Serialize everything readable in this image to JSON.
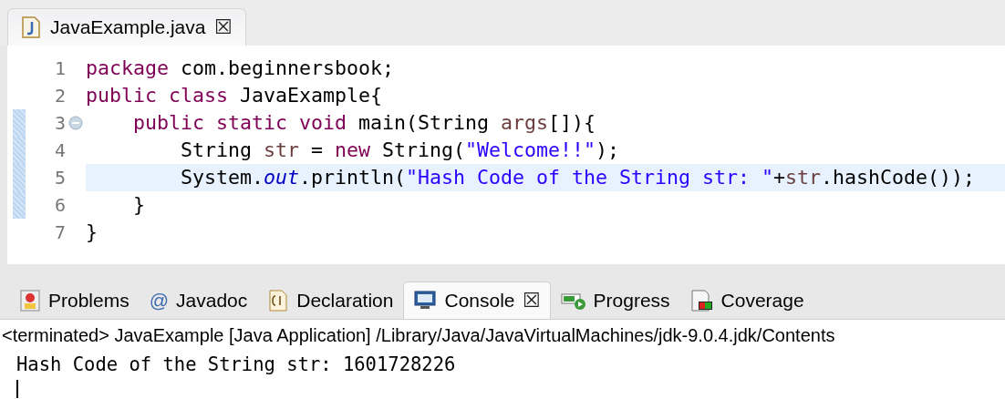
{
  "editor": {
    "tab": {
      "title": "JavaExample.java",
      "close": "☒",
      "selected": true
    },
    "lines": [
      {
        "number": "1",
        "changed": false,
        "current": false,
        "foldable": false,
        "tokens": [
          {
            "kind": "keyword",
            "text": "package"
          },
          {
            "kind": "plain",
            "text": " com.beginnersbook;"
          }
        ]
      },
      {
        "number": "2",
        "changed": false,
        "current": false,
        "foldable": false,
        "tokens": [
          {
            "kind": "keyword",
            "text": "public class"
          },
          {
            "kind": "plain",
            "text": " JavaExample{"
          }
        ]
      },
      {
        "number": "3",
        "changed": true,
        "current": false,
        "foldable": true,
        "tokens": [
          {
            "kind": "keyword",
            "text": "    public static void"
          },
          {
            "kind": "plain",
            "text": " main(String "
          },
          {
            "kind": "variable",
            "text": "args"
          },
          {
            "kind": "plain",
            "text": "[]){"
          }
        ]
      },
      {
        "number": "4",
        "changed": true,
        "current": false,
        "foldable": false,
        "tokens": [
          {
            "kind": "plain",
            "text": "        String "
          },
          {
            "kind": "variable",
            "text": "str"
          },
          {
            "kind": "plain",
            "text": " = "
          },
          {
            "kind": "keyword",
            "text": "new"
          },
          {
            "kind": "plain",
            "text": " String("
          },
          {
            "kind": "string",
            "text": "\"Welcome!!\""
          },
          {
            "kind": "plain",
            "text": ");"
          }
        ]
      },
      {
        "number": "5",
        "changed": true,
        "current": true,
        "foldable": false,
        "tokens": [
          {
            "kind": "plain",
            "text": "        System."
          },
          {
            "kind": "field",
            "text": "out"
          },
          {
            "kind": "plain",
            "text": ".println("
          },
          {
            "kind": "string",
            "text": "\"Hash Code of the String str: \""
          },
          {
            "kind": "plain",
            "text": "+"
          },
          {
            "kind": "variable",
            "text": "str"
          },
          {
            "kind": "plain",
            "text": ".hashCode());"
          }
        ]
      },
      {
        "number": "6",
        "changed": true,
        "current": false,
        "foldable": false,
        "tokens": [
          {
            "kind": "plain",
            "text": "    }"
          }
        ]
      },
      {
        "number": "7",
        "changed": false,
        "current": false,
        "foldable": false,
        "tokens": [
          {
            "kind": "plain",
            "text": "}"
          }
        ]
      }
    ]
  },
  "panel": {
    "tabs": [
      {
        "kind": "problems",
        "label": "Problems",
        "selected": false
      },
      {
        "kind": "javadoc",
        "label": "Javadoc",
        "icon_text": "@",
        "selected": false
      },
      {
        "kind": "declaration",
        "label": "Declaration",
        "selected": false
      },
      {
        "kind": "console",
        "label": "Console",
        "close": "☒",
        "selected": true
      },
      {
        "kind": "progress",
        "label": "Progress",
        "selected": false
      },
      {
        "kind": "coverage",
        "label": "Coverage",
        "selected": false
      }
    ],
    "console": {
      "header": "<terminated> JavaExample [Java Application] /Library/Java/JavaVirtualMachines/jdk-9.0.4.jdk/Contents",
      "output": "Hash Code of the String str: 1601728226"
    }
  }
}
